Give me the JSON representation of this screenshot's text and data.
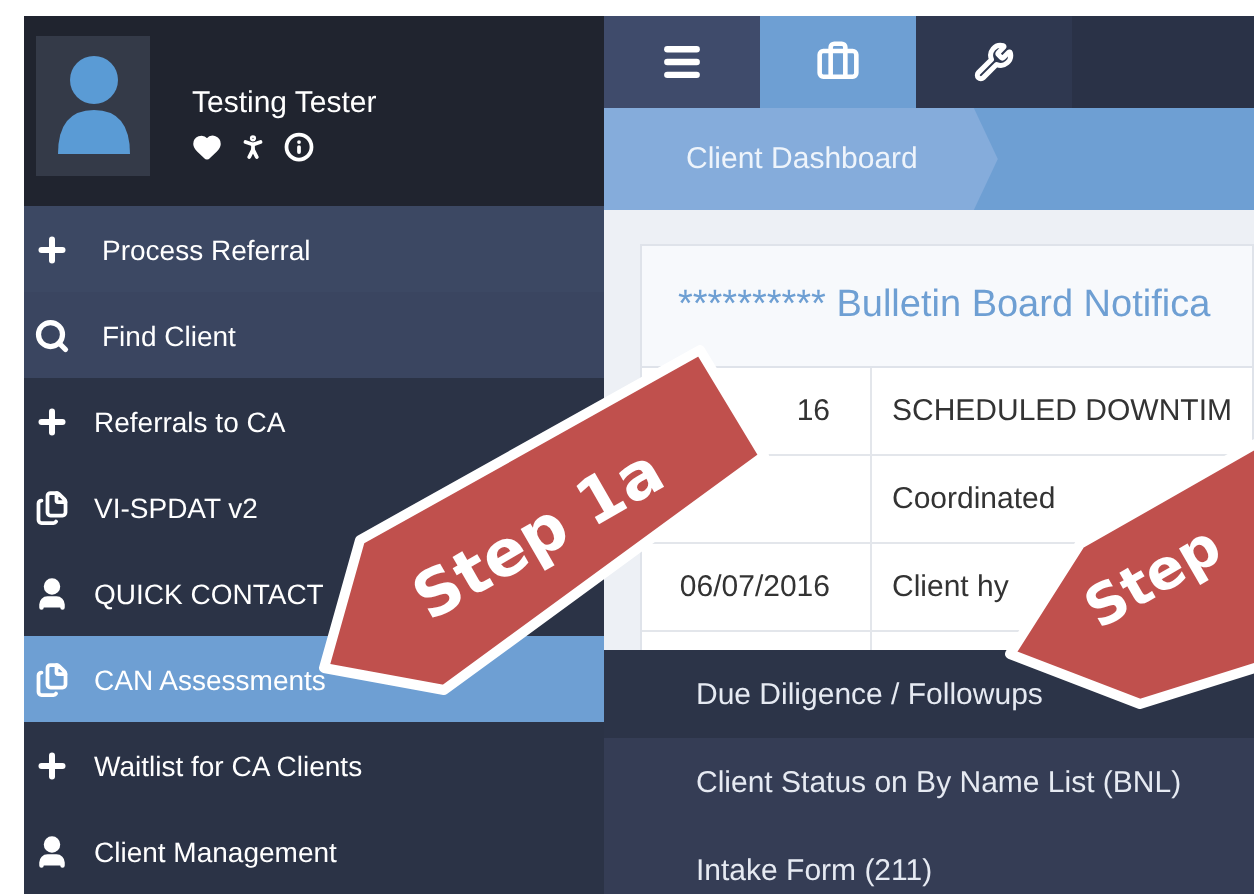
{
  "user": {
    "name": "Testing Tester"
  },
  "top_tabs": [
    {
      "kind": "menu",
      "selected": false
    },
    {
      "kind": "briefcase",
      "selected": true
    },
    {
      "kind": "wrench",
      "selected": false
    }
  ],
  "breadcrumb": "Client Dashboard",
  "sidebar": {
    "quick_actions": [
      {
        "kind": "add",
        "label": "Process Referral"
      },
      {
        "kind": "search",
        "label": "Find Client"
      }
    ],
    "menu": [
      {
        "kind": "add",
        "label": "Referrals to CA",
        "selected": false
      },
      {
        "kind": "form",
        "label": "VI-SPDAT v2",
        "selected": false
      },
      {
        "kind": "person",
        "label": "QUICK CONTACT",
        "selected": false
      },
      {
        "kind": "form",
        "label": "CAN Assessments",
        "selected": true
      },
      {
        "kind": "add",
        "label": "Waitlist for CA Clients",
        "selected": false
      },
      {
        "kind": "person",
        "label": "Client Management",
        "selected": false
      }
    ]
  },
  "bulletin": {
    "title": "********** Bulletin Board Notifica",
    "rows": [
      {
        "date": "16",
        "text": "SCHEDULED DOWNTIM"
      },
      {
        "date": "",
        "text": "Coordinated"
      },
      {
        "date": "06/07/2016",
        "text": "Client hy"
      },
      {
        "date": "",
        "text": ""
      }
    ]
  },
  "submenu": [
    {
      "label": "Due Diligence / Followups",
      "selected": true
    },
    {
      "label": "Client Status on By Name List (BNL)",
      "selected": false
    },
    {
      "label": "Intake Form (211)",
      "selected": false
    }
  ],
  "callouts": [
    {
      "label": "Step 1a"
    },
    {
      "label": "Step"
    }
  ]
}
